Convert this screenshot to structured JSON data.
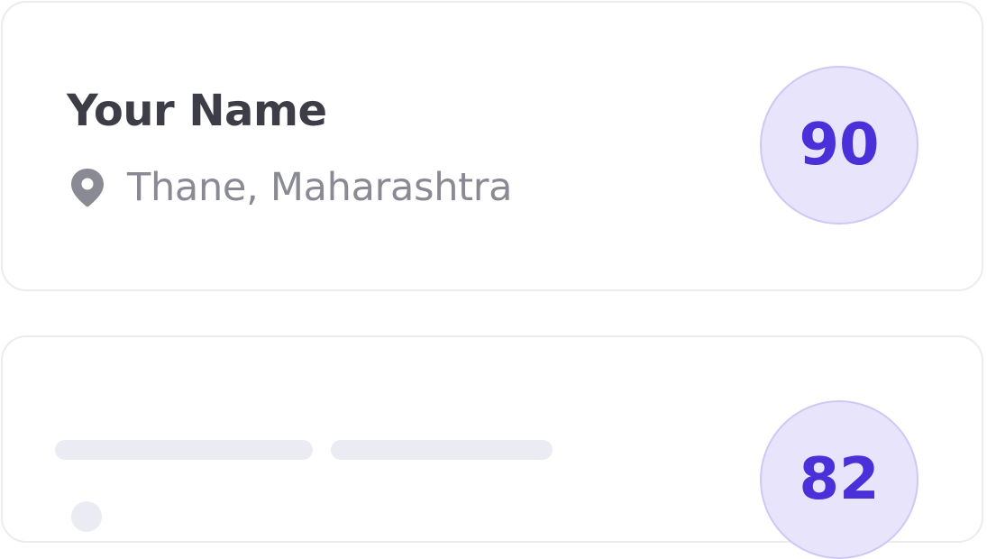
{
  "cards": [
    {
      "name": "Your Name",
      "location": "Thane, Maharashtra",
      "location_icon": "map-pin-icon",
      "score": "90"
    },
    {
      "state": "loading",
      "score": "82"
    }
  ],
  "colors": {
    "score_text": "#4a30d8",
    "score_bg": "#e7e4fb",
    "score_border": "#cfc8f6",
    "name_text": "#3d3d47",
    "location_text": "#8a8a94",
    "skeleton": "#ebebf3",
    "card_border": "#ebebf0"
  }
}
